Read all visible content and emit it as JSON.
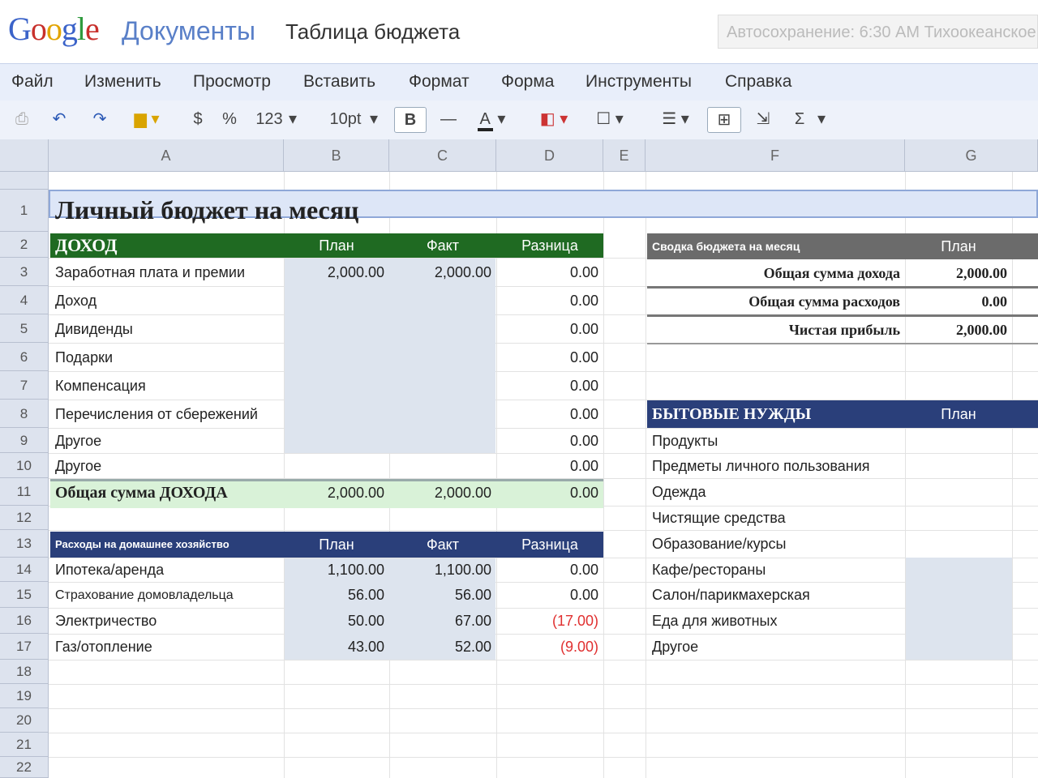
{
  "app": {
    "logo_google": [
      "G",
      "o",
      "o",
      "g",
      "l",
      "e"
    ],
    "logo_docs": "Документы",
    "doc_title": "Таблица бюджета",
    "autosave": "Автосохранение: 6:30 AM Тихоокеанское"
  },
  "menu": [
    "Файл",
    "Изменить",
    "Просмотр",
    "Вставить",
    "Формат",
    "Форма",
    "Инструменты",
    "Справка"
  ],
  "toolbar": {
    "currency": "$",
    "percent": "%",
    "number_format": "123",
    "font_size": "10pt",
    "bold": "B",
    "sum": "Σ"
  },
  "columns": [
    "A",
    "B",
    "C",
    "D",
    "E",
    "F",
    "G"
  ],
  "rows": [
    "1",
    "2",
    "3",
    "4",
    "5",
    "6",
    "7",
    "8",
    "9",
    "10",
    "11",
    "12",
    "13",
    "14",
    "15",
    "16",
    "17",
    "18",
    "19",
    "20",
    "21",
    "22"
  ],
  "sheet": {
    "title": "Личный бюджет на месяц",
    "income": {
      "header": [
        "ДОХОД",
        "План",
        "Факт",
        "Разница"
      ],
      "rows": [
        {
          "label": "Заработная плата и премии",
          "plan": "2,000.00",
          "fact": "2,000.00",
          "diff": "0.00"
        },
        {
          "label": "Доход",
          "plan": "",
          "fact": "",
          "diff": "0.00"
        },
        {
          "label": "Дивиденды",
          "plan": "",
          "fact": "",
          "diff": "0.00"
        },
        {
          "label": "Подарки",
          "plan": "",
          "fact": "",
          "diff": "0.00"
        },
        {
          "label": "Компенсация",
          "plan": "",
          "fact": "",
          "diff": "0.00"
        },
        {
          "label": "Перечисления от сбережений",
          "plan": "",
          "fact": "",
          "diff": "0.00"
        },
        {
          "label": "Другое",
          "plan": "",
          "fact": "",
          "diff": "0.00"
        },
        {
          "label": "Другое",
          "plan": "",
          "fact": "",
          "diff": "0.00"
        }
      ],
      "total": {
        "label": "Общая сумма ДОХОДА",
        "plan": "2,000.00",
        "fact": "2,000.00",
        "diff": "0.00"
      }
    },
    "home": {
      "header": [
        "Расходы на домашнее хозяйство",
        "План",
        "Факт",
        "Разница"
      ],
      "rows": [
        {
          "label": "Ипотека/аренда",
          "plan": "1,100.00",
          "fact": "1,100.00",
          "diff": "0.00"
        },
        {
          "label": "Страхование домовладельца",
          "plan": "56.00",
          "fact": "56.00",
          "diff": "0.00"
        },
        {
          "label": "Электричество",
          "plan": "50.00",
          "fact": "67.00",
          "diff": "(17.00)"
        },
        {
          "label": "Газ/отопление",
          "plan": "43.00",
          "fact": "52.00",
          "diff": "(9.00)"
        }
      ]
    },
    "summary": {
      "header": [
        "Сводка бюджета на месяц",
        "План"
      ],
      "rows": [
        {
          "label": "Общая сумма дохода",
          "value": "2,000.00"
        },
        {
          "label": "Общая сумма расходов",
          "value": "0.00"
        },
        {
          "label": "Чистая прибыль",
          "value": "2,000.00"
        }
      ]
    },
    "living": {
      "header": [
        "БЫТОВЫЕ НУЖДЫ",
        "План"
      ],
      "rows": [
        "Продукты",
        "Предметы личного пользования",
        "Одежда",
        "Чистящие средства",
        "Образование/курсы",
        "Кафе/рестораны",
        "Салон/парикмахерская",
        "Еда для животных",
        "Другое"
      ]
    }
  }
}
